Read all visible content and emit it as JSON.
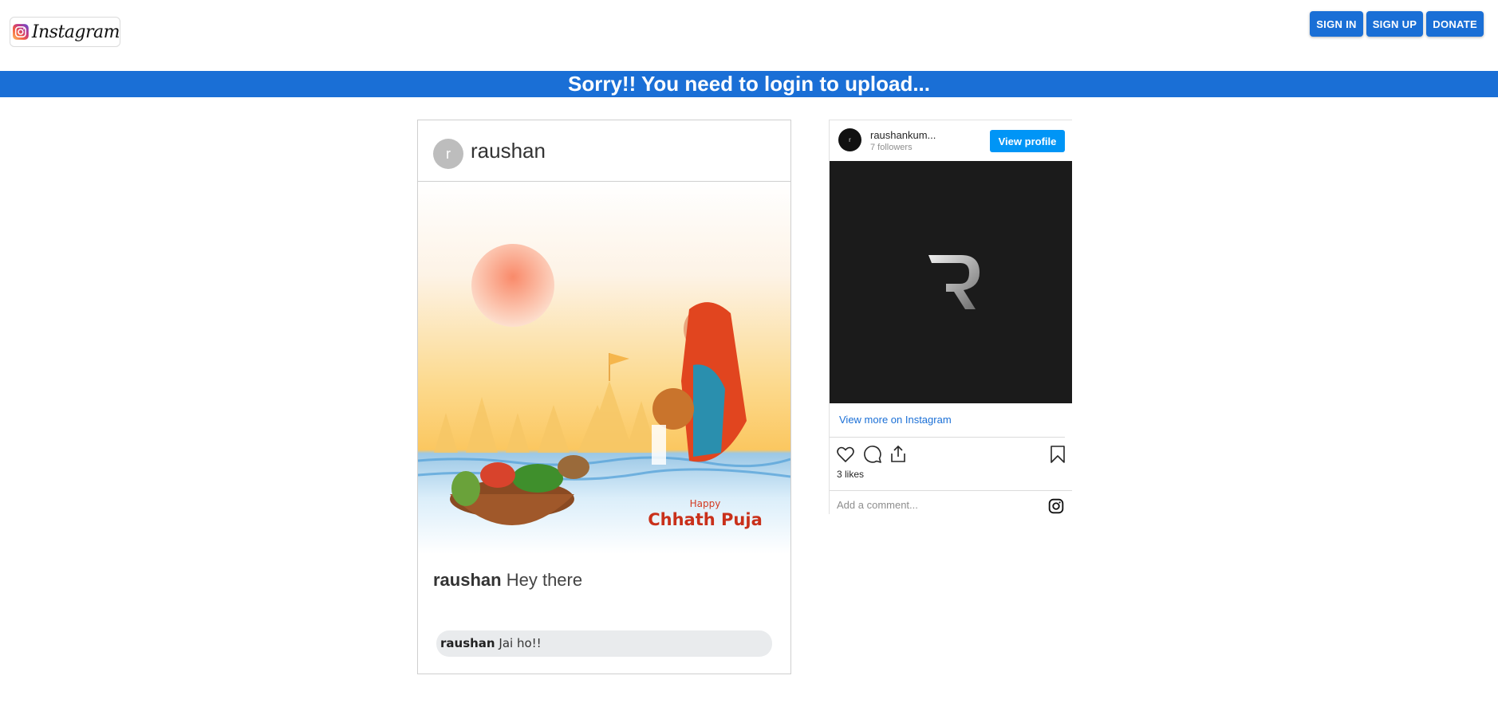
{
  "header": {
    "logo_text": "Instagram",
    "buttons": {
      "sign_in": "SIGN IN",
      "sign_up": "SIGN UP",
      "donate": "DONATE"
    }
  },
  "banner": {
    "text": "Sorry!! You need to login to upload..."
  },
  "post": {
    "avatar_letter": "r",
    "username": "raushan",
    "image_text": {
      "happy": "Happy",
      "title": "Chhath Puja"
    },
    "caption_user": "raushan",
    "caption_text": "Hey there",
    "comment": {
      "user": "raushan",
      "text": "Jai ho!!"
    }
  },
  "embed": {
    "avatar_letter": "r",
    "username": "raushankum...",
    "followers": "7 followers",
    "view_profile": "View profile",
    "view_more": "View more on Instagram",
    "likes": "3 likes",
    "comment_placeholder": "Add a comment..."
  },
  "colors": {
    "primary": "#1a6fd6",
    "instagram_blue": "#0095f6"
  }
}
